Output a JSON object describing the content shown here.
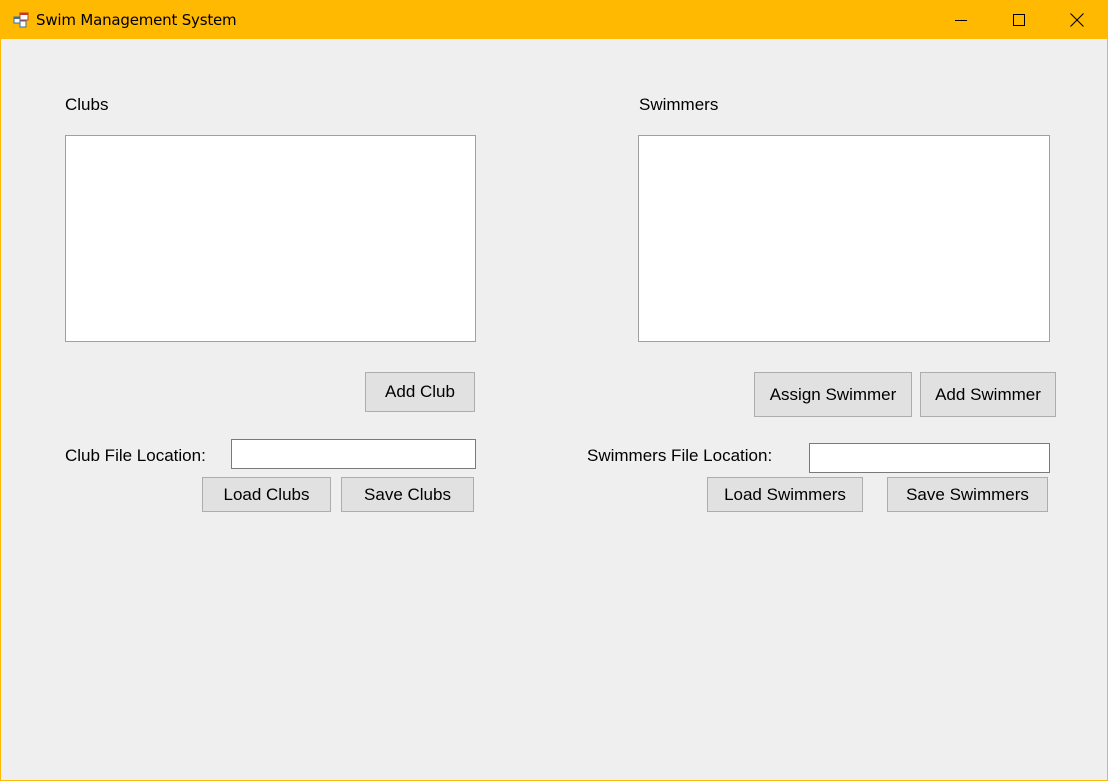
{
  "window": {
    "title": "Swim Management System",
    "icons": {
      "app": "form-app-icon",
      "minimize": "minimize-icon",
      "maximize": "maximize-icon",
      "close": "close-icon"
    },
    "colors": {
      "titlebar": "#ffb900",
      "client": "#efefef",
      "button_face": "#e1e1e1"
    }
  },
  "clubs": {
    "heading": "Clubs",
    "items": [],
    "add_label": "Add Club",
    "file_label": "Club File Location:",
    "file_value": "",
    "load_label": "Load Clubs",
    "save_label": "Save Clubs"
  },
  "swimmers": {
    "heading": "Swimmers",
    "items": [],
    "assign_label": "Assign Swimmer",
    "add_label": "Add Swimmer",
    "file_label": "Swimmers File Location:",
    "file_value": "",
    "load_label": "Load Swimmers",
    "save_label": "Save Swimmers"
  }
}
